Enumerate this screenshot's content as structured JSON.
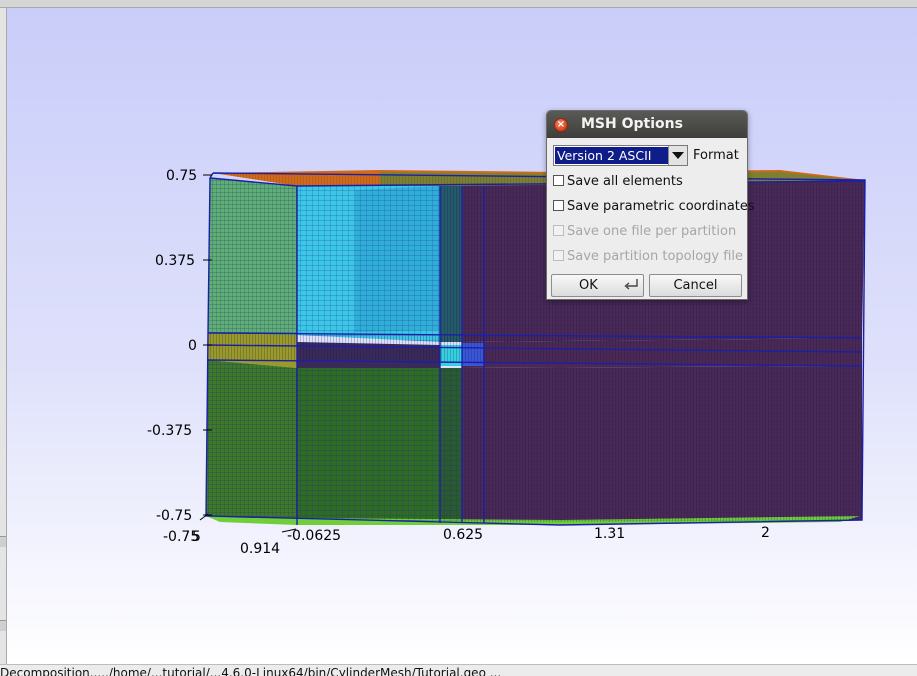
{
  "viewport": {
    "y_axis_ticks": [
      "0.75",
      "0.375",
      "0",
      "-0.375",
      "-0.75"
    ],
    "x_axis_ticks": [
      "-0.0625",
      "0.625",
      "1.31",
      "2"
    ],
    "depth_axis_ticks": [
      "-0.75",
      "0.914"
    ],
    "corner_fragment": "5"
  },
  "dialog": {
    "title": "MSH Options",
    "format_value": "Version 2 ASCII",
    "format_label": "Format",
    "options": [
      {
        "label": "Save all elements",
        "checked": false,
        "enabled": true
      },
      {
        "label": "Save parametric coordinates",
        "checked": false,
        "enabled": true
      },
      {
        "label": "Save one file per partition",
        "checked": false,
        "enabled": false
      },
      {
        "label": "Save partition topology file",
        "checked": false,
        "enabled": false
      }
    ],
    "ok_label": "OK",
    "cancel_label": "Cancel"
  },
  "status_bar": {
    "text": "Decomposition...../home/...tutorial/...4.6.0-Linux64/bin/CylinderMesh/Tutorial.geo ..."
  },
  "colors": {
    "dialog_title_bg": "#4a4a47",
    "select_highlight": "#0f1d8a",
    "mesh_purple": "#4b2a55",
    "mesh_green": "#3f7a2a",
    "mesh_cyan": "#3cc7e6",
    "mesh_lime": "#6fcf3a",
    "mesh_orange": "#d06a1a",
    "mesh_olive": "#7d8030",
    "mesh_edges": "#1b1fa8"
  }
}
